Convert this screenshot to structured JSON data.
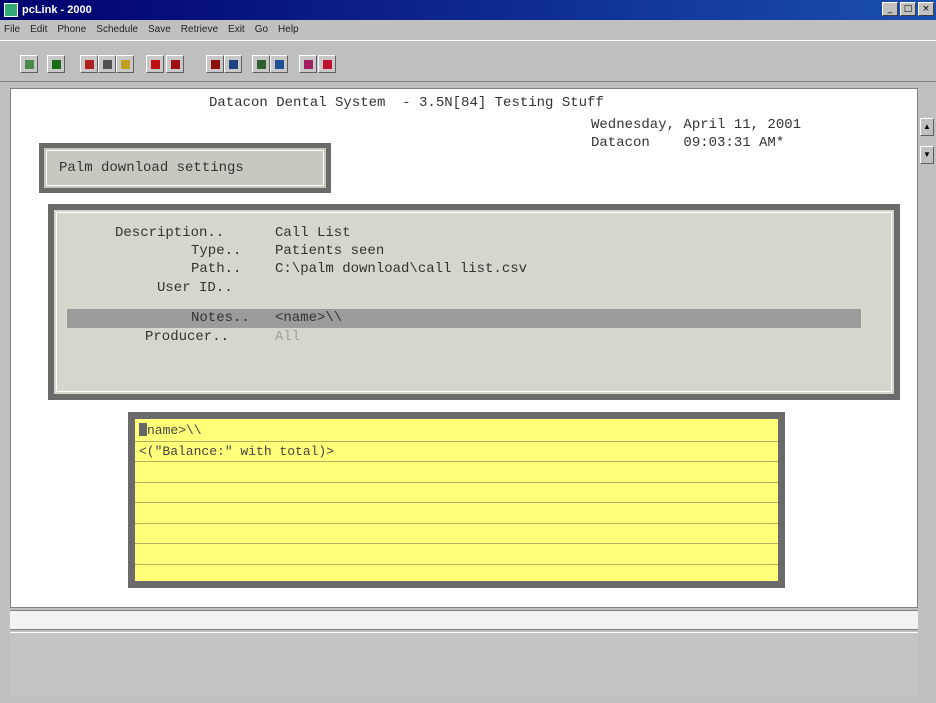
{
  "window": {
    "title": "pcLink - 2000",
    "buttons": [
      "_",
      "□",
      "×"
    ]
  },
  "menu": [
    "File",
    "Edit",
    "Phone",
    "Schedule",
    "Save",
    "Retrieve",
    "Exit",
    "Go",
    "Help"
  ],
  "toolbar": {
    "buttons": [
      {
        "name": "notepad-icon",
        "color": "#4a8a4a"
      },
      {
        "name": "terminal-icon",
        "color": "#1a6a1a"
      },
      {
        "name": "patients-icon",
        "color": "#b02020"
      },
      {
        "name": "print-icon",
        "color": "#505050"
      },
      {
        "name": "star-icon",
        "color": "#c0a020"
      },
      {
        "name": "apple-icon",
        "color": "#c01010"
      },
      {
        "name": "chart-icon",
        "color": "#a01010"
      },
      {
        "name": "tools-icon",
        "color": "#8a1010"
      },
      {
        "name": "calendar-icon",
        "color": "#204080"
      },
      {
        "name": "photo-icon",
        "color": "#306030"
      },
      {
        "name": "window-icon",
        "color": "#205090"
      },
      {
        "name": "dots-icon",
        "color": "#a02060"
      },
      {
        "name": "flower-icon",
        "color": "#c01030"
      }
    ]
  },
  "terminal": {
    "header": "Datacon Dental System  - 3.5N[84] Testing Stuff",
    "date": "Wednesday, April 11, 2001",
    "site": "Datacon",
    "time": "09:03:31 AM*",
    "settings_label": "Palm download settings"
  },
  "fields": {
    "description": {
      "label": "Description..",
      "value": "Call List"
    },
    "type": {
      "label": "Type..",
      "value": "Patients seen"
    },
    "path": {
      "label": "Path..",
      "value": "C:\\palm download\\call list.csv"
    },
    "user_id": {
      "label": "User ID..",
      "value": ""
    },
    "notes": {
      "label": "Notes..",
      "value": "<name>\\\\"
    },
    "producer": {
      "label": "Producer..",
      "value": "All"
    }
  },
  "notes_editor": {
    "lines": [
      "name>\\\\",
      "<(\"Balance:\" with total)>",
      "",
      "",
      "",
      "",
      ""
    ]
  },
  "colors": {
    "titlebar": "#00006e",
    "notes_background": "#ffff7a",
    "highlight": "#9b9b9b"
  }
}
